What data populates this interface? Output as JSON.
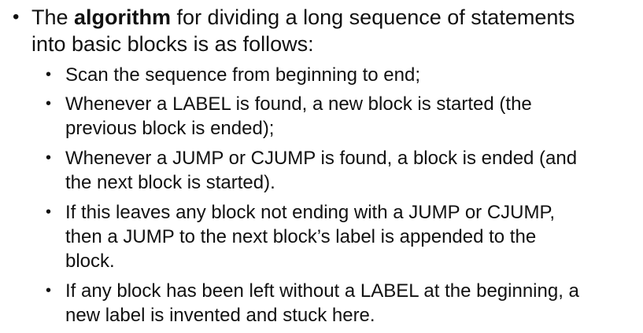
{
  "slide": {
    "main_bullet": {
      "before": "The ",
      "emphasis": "algorithm",
      "after": " for dividing a long sequence of statements\ninto basic blocks is as follows:"
    },
    "sub_bullets": [
      "Scan the sequence from beginning to end;",
      "Whenever a LABEL is found, a new block is started (the\nprevious block is ended);",
      "Whenever a JUMP or CJUMP is found, a block is ended (and\nthe next block is started).",
      "If this leaves any block not ending with a JUMP or CJUMP,\nthen a JUMP to the next block’s label is appended to the\nblock.",
      "If any block has been left without a LABEL at the beginning, a\nnew label is invented and stuck here."
    ],
    "bullet_glyph": "•"
  }
}
